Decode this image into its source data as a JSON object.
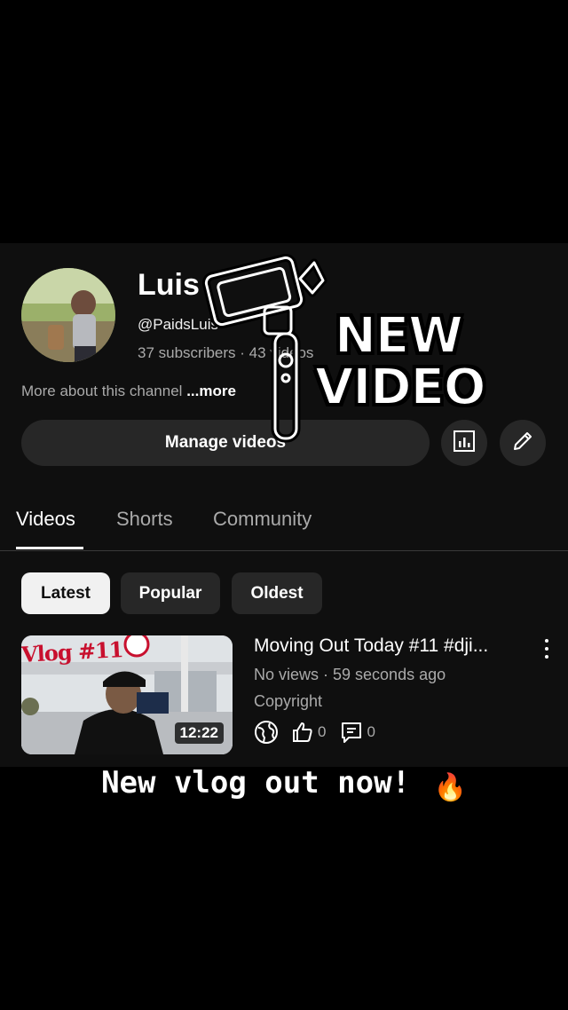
{
  "channel": {
    "name": "Luis",
    "handle": "@PaidsLuis",
    "stats": "37 subscribers · 43 videos",
    "about": "More about this channel",
    "about_more": "...more"
  },
  "actions": {
    "manage_label": "Manage videos",
    "analytics_icon": "analytics-icon",
    "edit_icon": "pencil-icon"
  },
  "tabs": [
    {
      "label": "Videos",
      "active": true
    },
    {
      "label": "Shorts",
      "active": false
    },
    {
      "label": "Community",
      "active": false
    }
  ],
  "filters": [
    {
      "label": "Latest",
      "active": true
    },
    {
      "label": "Popular",
      "active": false
    },
    {
      "label": "Oldest",
      "active": false
    }
  ],
  "video": {
    "thumbnail_text": "Vlog #11",
    "duration": "12:22",
    "title": "Moving Out Today #11 #dji...",
    "meta": "No views · 59 seconds ago",
    "visibility": "Copyright",
    "likes": "0",
    "comments": "0"
  },
  "overlay": {
    "sticker_text_line1": "NEW",
    "sticker_text_line2": "VIDEO",
    "caption": "New vlog out now!",
    "caption_emoji": "🔥"
  },
  "colors": {
    "background": "#0f0f0f",
    "surface": "#272727",
    "secondary_text": "#aaaaaa"
  }
}
